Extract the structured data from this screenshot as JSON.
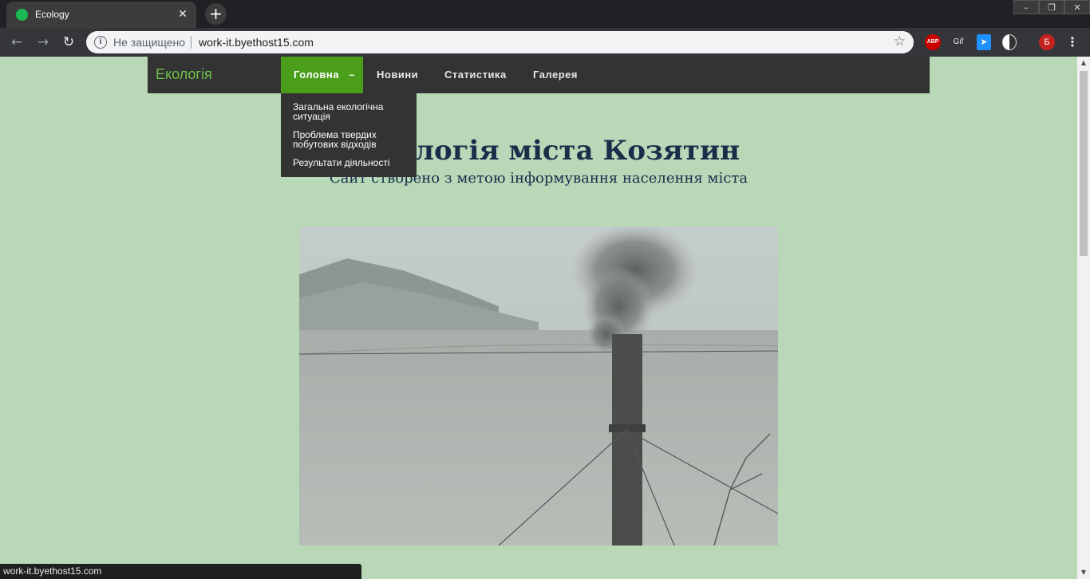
{
  "browser": {
    "tab_title": "Ecology",
    "tab_close": "✕",
    "new_tab": "+",
    "window_controls": [
      "–",
      "❐",
      "✕"
    ],
    "nav_back": "←",
    "nav_forward": "→",
    "nav_reload": "↻",
    "info_glyph": "i",
    "security_label": "Не защищено",
    "url": "work-it.byethost15.com",
    "bookmark_glyph": "☆",
    "extensions": {
      "abp": "ABP",
      "gif": "Gif",
      "arrow": "➤",
      "avatar": "Б",
      "menu": "⋮"
    },
    "status_url": "work-it.byethost15.com"
  },
  "site": {
    "brand": "Екологія",
    "nav": {
      "home": "Головна",
      "home_toggle": "–",
      "news": "Новини",
      "stats": "Статистика",
      "gallery": "Галерея"
    },
    "dropdown": [
      "Загальна екологічна ситуація",
      "Проблема твердих побутових відходів",
      "Результати діяльності"
    ],
    "hero_title": "Екологія міста Козятин",
    "hero_subtitle": "Сайт створено з метою інформування населення міста"
  },
  "scrollbar": {
    "up": "▲",
    "down": "▼"
  },
  "colors": {
    "page_bg": "#b8d8b8",
    "navbar_bg": "#333333",
    "brand": "#6cc04a",
    "active_nav": "#4a9e1a",
    "title_text": "#1a2e4a"
  }
}
